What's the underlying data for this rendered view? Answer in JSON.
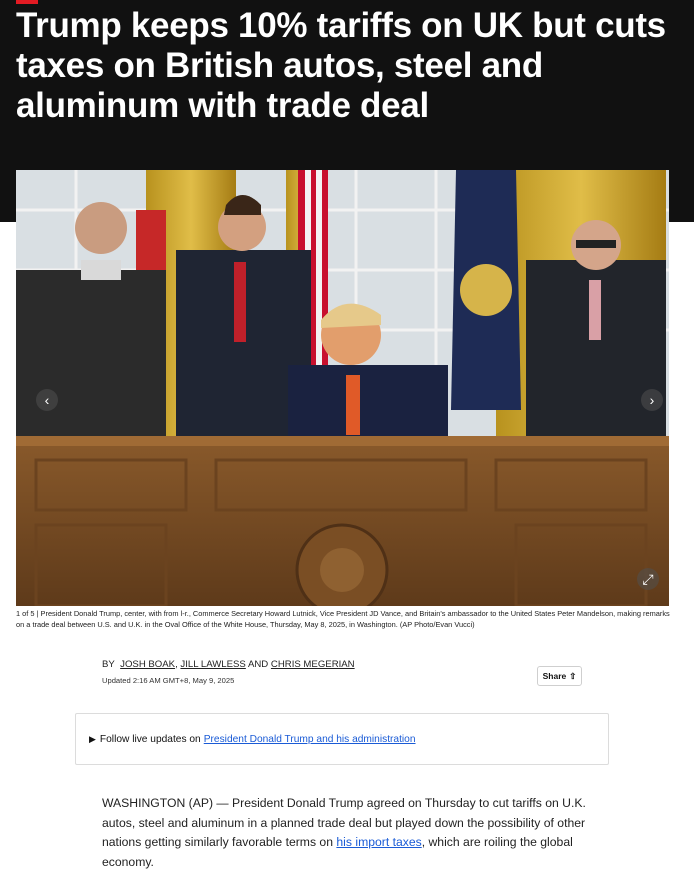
{
  "article": {
    "headline": "Trump keeps 10% tariffs on UK but cuts taxes on British autos, steel and aluminum with trade deal",
    "photo": {
      "counter": "1 of 5",
      "separator": "|",
      "caption": "President Donald Trump, center, with from l-r., Commerce Secretary Howard Lutnick, Vice President JD Vance, and Britain's ambassador to the United States Peter Mandelson, making remarks on a trade deal between U.S. and U.K. in the Oval Office of the White House, Thursday, May 8, 2025, in Washington. (AP Photo/Evan Vucci)",
      "prev_icon": "chevron-left-icon",
      "next_icon": "chevron-right-icon",
      "expand_icon": "expand-icon"
    },
    "byline": {
      "prefix": "BY",
      "authors": [
        "JOSH BOAK",
        "JILL LAWLESS",
        "CHRIS MEGERIAN"
      ],
      "comma": ",",
      "and": "AND",
      "updated": "Updated 2:16 AM GMT+8, May 9, 2025"
    },
    "share": {
      "label": "Share",
      "icon": "share-icon"
    },
    "live_updates": {
      "prefix": "Follow live updates on",
      "link": "President Donald Trump and his administration"
    },
    "body": {
      "p1_before": "WASHINGTON (AP) — President Donald Trump agreed on Thursday to cut tariffs on U.K. autos, steel and aluminum in a planned trade deal but played down the possibility of other nations getting similarly favorable terms on",
      "p1_link": "his import taxes",
      "p1_after": ", which are roiling the global economy."
    }
  },
  "colors": {
    "hero_bg": "#111111",
    "accent_red": "#e31b23",
    "link_blue": "#1a5bd6"
  }
}
